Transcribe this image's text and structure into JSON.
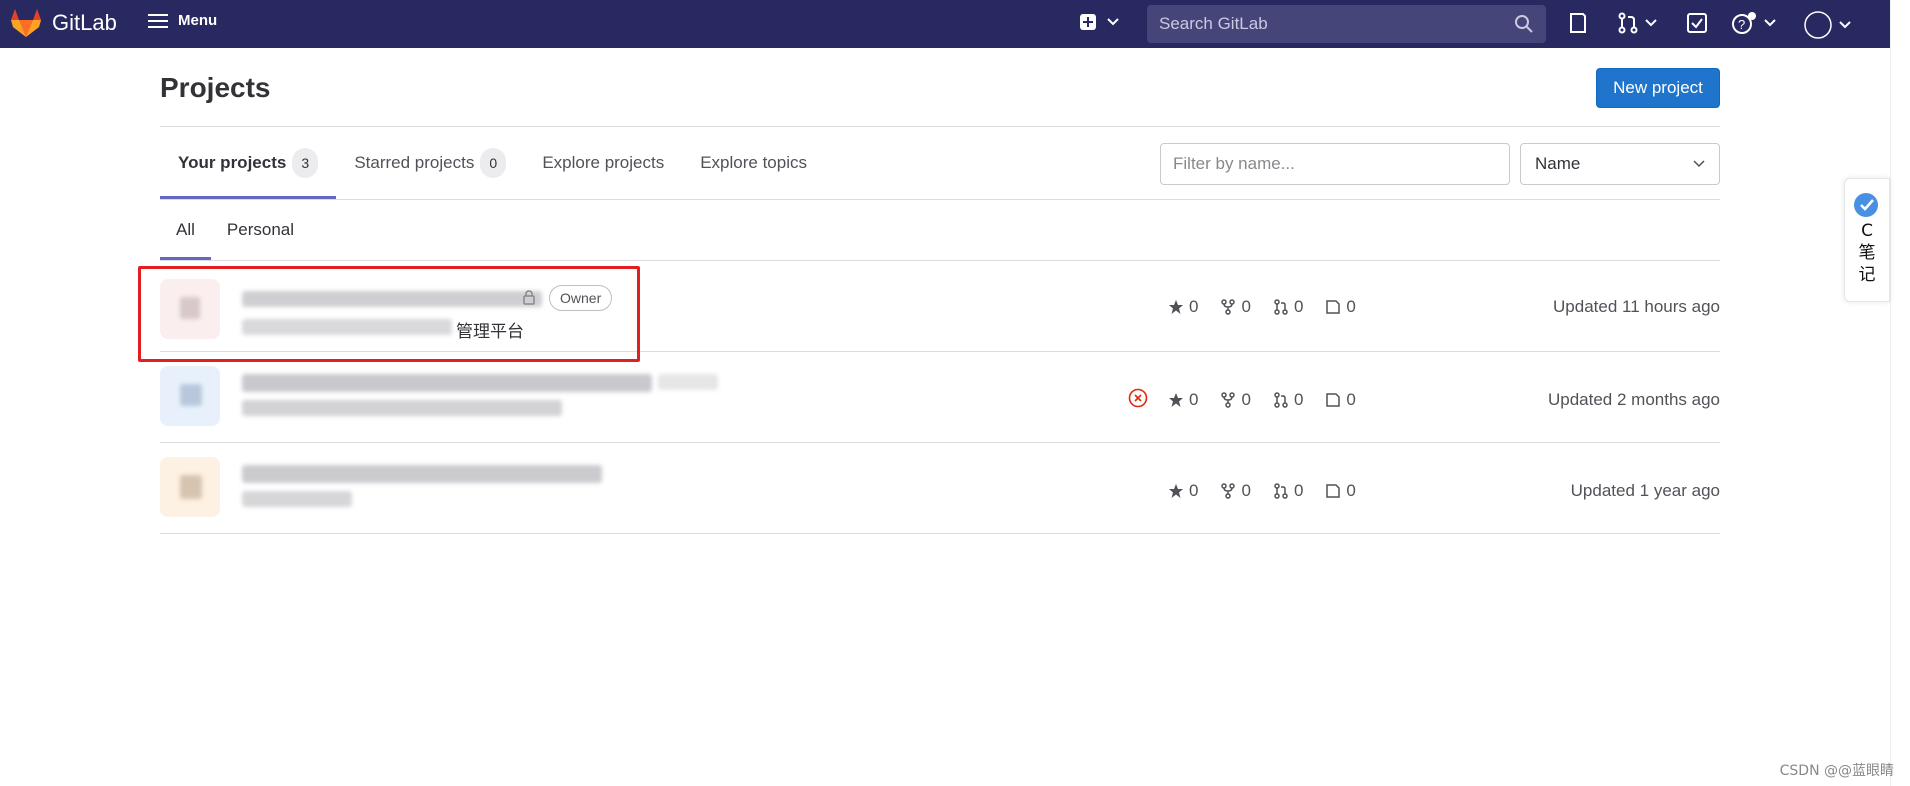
{
  "navbar": {
    "brand": "GitLab",
    "menu_label": "Menu",
    "search_placeholder": "Search GitLab"
  },
  "page": {
    "title": "Projects",
    "new_project_label": "New project"
  },
  "tabs": [
    {
      "label": "Your projects",
      "count": "3",
      "active": true
    },
    {
      "label": "Starred projects",
      "count": "0",
      "active": false
    },
    {
      "label": "Explore projects",
      "active": false
    },
    {
      "label": "Explore topics",
      "active": false
    }
  ],
  "filter": {
    "placeholder": "Filter by name..."
  },
  "sort": {
    "selected": "Name"
  },
  "subtabs": [
    {
      "label": "All",
      "active": true
    },
    {
      "label": "Personal",
      "active": false
    }
  ],
  "projects": [
    {
      "role": "Owner",
      "description_visible": "管理平台",
      "stars": "0",
      "forks": "0",
      "merge_requests": "0",
      "issues": "0",
      "updated": "Updated 11 hours ago",
      "avatar_color": "#fbeeee"
    },
    {
      "stars": "0",
      "forks": "0",
      "merge_requests": "0",
      "issues": "0",
      "updated": "Updated 2 months ago",
      "avatar_color": "#e8f1fb",
      "pipeline_status": "failed"
    },
    {
      "stars": "0",
      "forks": "0",
      "merge_requests": "0",
      "issues": "0",
      "updated": "Updated 1 year ago",
      "avatar_color": "#fdf1e3"
    }
  ],
  "side_widget": {
    "chars": [
      "C",
      "笔",
      "记"
    ]
  },
  "watermark": "CSDN @@蓝眼睛",
  "colors": {
    "navbar": "#292961",
    "primary_button": "#1f75cb",
    "active_tab_underline": "#6666c4",
    "highlight_box": "#e02020",
    "failed_status": "#dd2b0e"
  }
}
